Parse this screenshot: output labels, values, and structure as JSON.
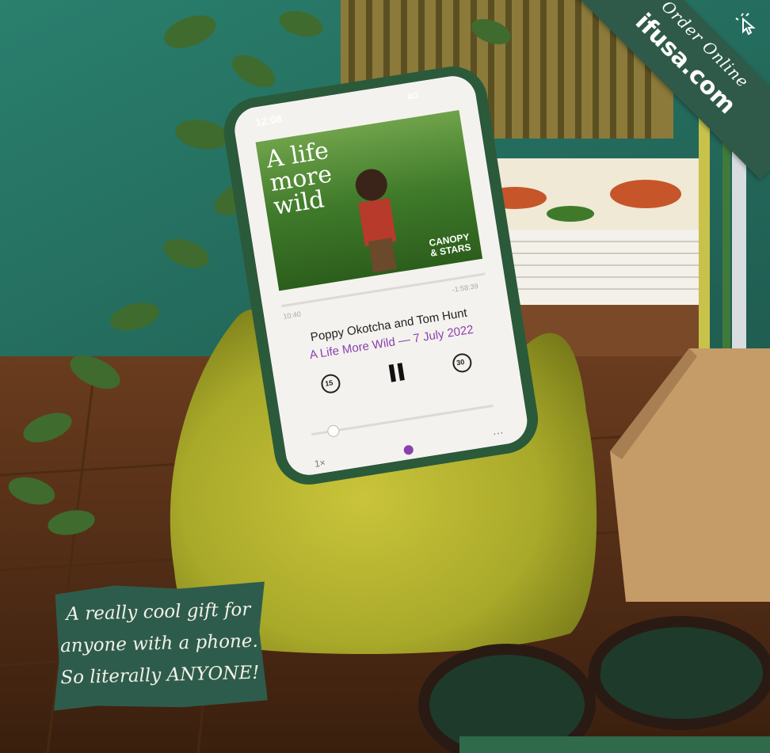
{
  "phone": {
    "status_time": "12:08",
    "status_network": "4G",
    "podcast_title_line1": "A life",
    "podcast_title_line2": "more",
    "podcast_title_line3": "wild",
    "podcast_brand_line1": "CANOPY",
    "podcast_brand_line2": "& STARS",
    "elapsed_time": "10:40",
    "remaining_time": "-1:58:39",
    "episode_guest": "Poppy Okotcha and Tom Hunt",
    "episode_title": "A Life More Wild — 7 July 2022",
    "skip_back_seconds": "15",
    "skip_forward_seconds": "30",
    "playback_speed": "1×",
    "more_label": "···"
  },
  "ribbon": {
    "order_label": "Order Online",
    "site": "ifusa.com"
  },
  "caption": {
    "line1": "A really cool gift for",
    "line2": "anyone with a phone.",
    "line3": "So literally ANYONE!"
  },
  "colors": {
    "brand_green": "#2f5a49",
    "stand_yellow": "#b6b531",
    "wall_teal": "#2e7a6a",
    "accent_purple": "#8a3fb0"
  }
}
